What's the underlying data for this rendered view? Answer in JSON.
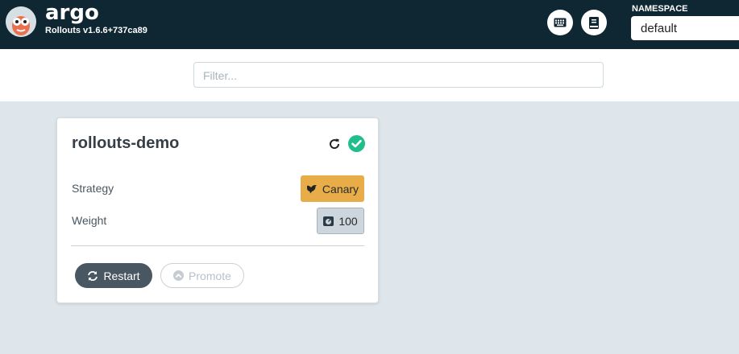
{
  "header": {
    "brand_name": "argo",
    "version": "Rollouts v1.6.6+737ca89",
    "keyboard_icon": "keyboard-icon",
    "docs_icon": "book-icon",
    "namespace_label": "NAMESPACE",
    "namespace_value": "default"
  },
  "filter": {
    "placeholder": "Filter..."
  },
  "rollout": {
    "name": "rollouts-demo",
    "status_icon": "check-circle-icon",
    "status_color": "#1fbe8c",
    "strategy_label": "Strategy",
    "strategy_value": "Canary",
    "strategy_color": "#e8ac48",
    "weight_label": "Weight",
    "weight_value": "100",
    "restart_label": "Restart",
    "promote_label": "Promote"
  }
}
